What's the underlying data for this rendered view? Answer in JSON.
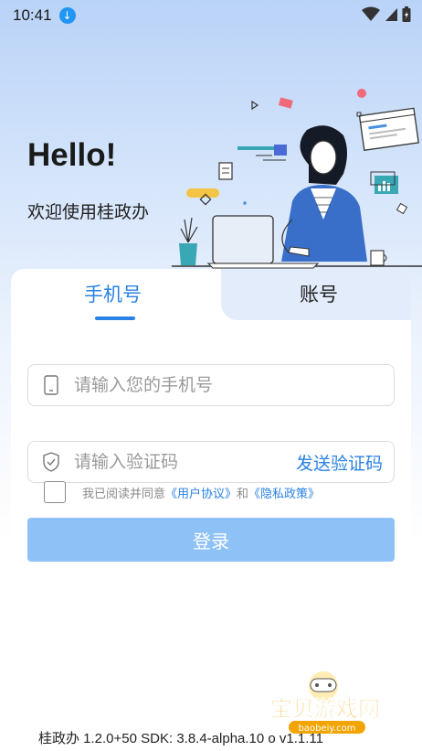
{
  "status_bar": {
    "time": "10:41"
  },
  "header": {
    "greeting": "Hello!",
    "welcome": "欢迎使用桂政办"
  },
  "tabs": [
    {
      "label": "手机号",
      "active": true
    },
    {
      "label": "账号",
      "active": false
    }
  ],
  "form": {
    "phone_placeholder": "请输入您的手机号",
    "code_placeholder": "请输入验证码",
    "send_code_label": "发送验证码",
    "agreement_prefix": "我已阅读并同意",
    "user_agreement": "《用户协议》",
    "and_text": "和",
    "privacy_policy": "《隐私政策》",
    "login_label": "登录"
  },
  "footer": {
    "version": "桂政办 1.2.0+50 SDK: 3.8.4-alpha.10 o v1.1.11"
  },
  "watermark": {
    "title": "宝贝游戏网",
    "url": "baobeiy.com"
  },
  "colors": {
    "accent": "#2a82e4",
    "button": "#8ec2f7"
  }
}
